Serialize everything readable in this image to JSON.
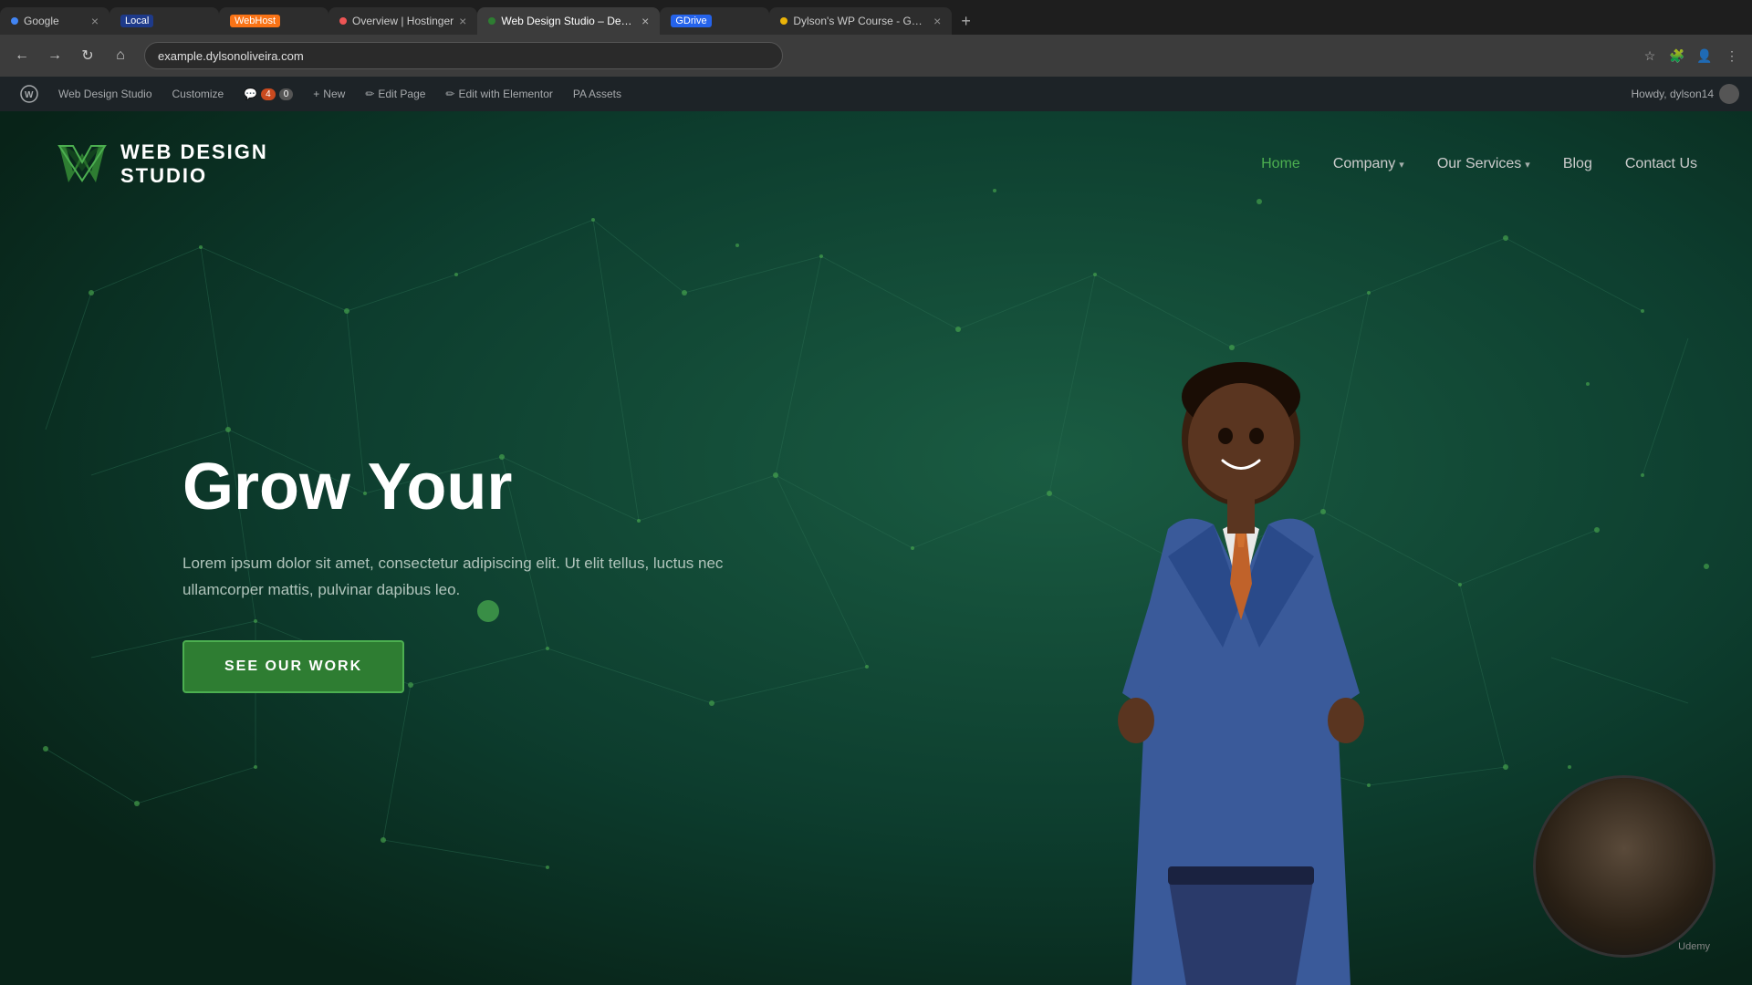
{
  "browser": {
    "tabs": [
      {
        "id": "google",
        "label": "Google",
        "favicon_color": "#4285f4",
        "active": false,
        "closable": true
      },
      {
        "id": "local",
        "label": "Local",
        "badge": "Local",
        "badge_color": "#1e3a8a",
        "active": false,
        "closable": false
      },
      {
        "id": "webhost",
        "label": "WebHost",
        "badge": "WebHost",
        "badge_color": "#f97316",
        "active": false,
        "closable": false
      },
      {
        "id": "hostinger",
        "label": "Overview | Hostinger",
        "active": false,
        "closable": true
      },
      {
        "id": "webdesign",
        "label": "Web Design Studio – Design...",
        "active": true,
        "closable": true
      },
      {
        "id": "gdrive",
        "label": "GDrive",
        "badge": "GDrive",
        "badge_color": "#2563eb",
        "active": false,
        "closable": false
      },
      {
        "id": "dylson",
        "label": "Dylson's WP Course - Goog...",
        "active": false,
        "closable": true
      }
    ],
    "address_bar": "example.dylsonoliveira.com",
    "new_tab_label": "+"
  },
  "wp_admin": {
    "wp_icon": "W",
    "site_name": "Web Design Studio",
    "customize": "Customize",
    "comments_count": "4",
    "comments_zero": "0",
    "new": "New",
    "edit_page": "Edit Page",
    "edit_elementor": "Edit with Elementor",
    "pa_assets": "PA Assets",
    "howdy": "Howdy, dylson14"
  },
  "site": {
    "logo_top": "W",
    "logo_line1": "WEB DESIGN",
    "logo_line2": "STUDIO"
  },
  "nav": {
    "home": "Home",
    "company": "Company",
    "our_services": "Our Services",
    "blog": "Blog",
    "contact_us": "Contact Us"
  },
  "hero": {
    "title": "Grow Your",
    "body_text": "Lorem ipsum dolor sit amet, consectetur adipiscing elit. Ut elit tellus, luctus nec ullamcorper mattis, pulvinar dapibus leo.",
    "cta_button": "SEE OUR WORK"
  },
  "webcam": {
    "label": "Udemy"
  },
  "colors": {
    "hero_bg": "#0d3d2e",
    "nav_active": "#4caf50",
    "cta_bg": "#2e7d32",
    "cta_border": "#4caf50",
    "logo_green": "#2e7d32"
  }
}
